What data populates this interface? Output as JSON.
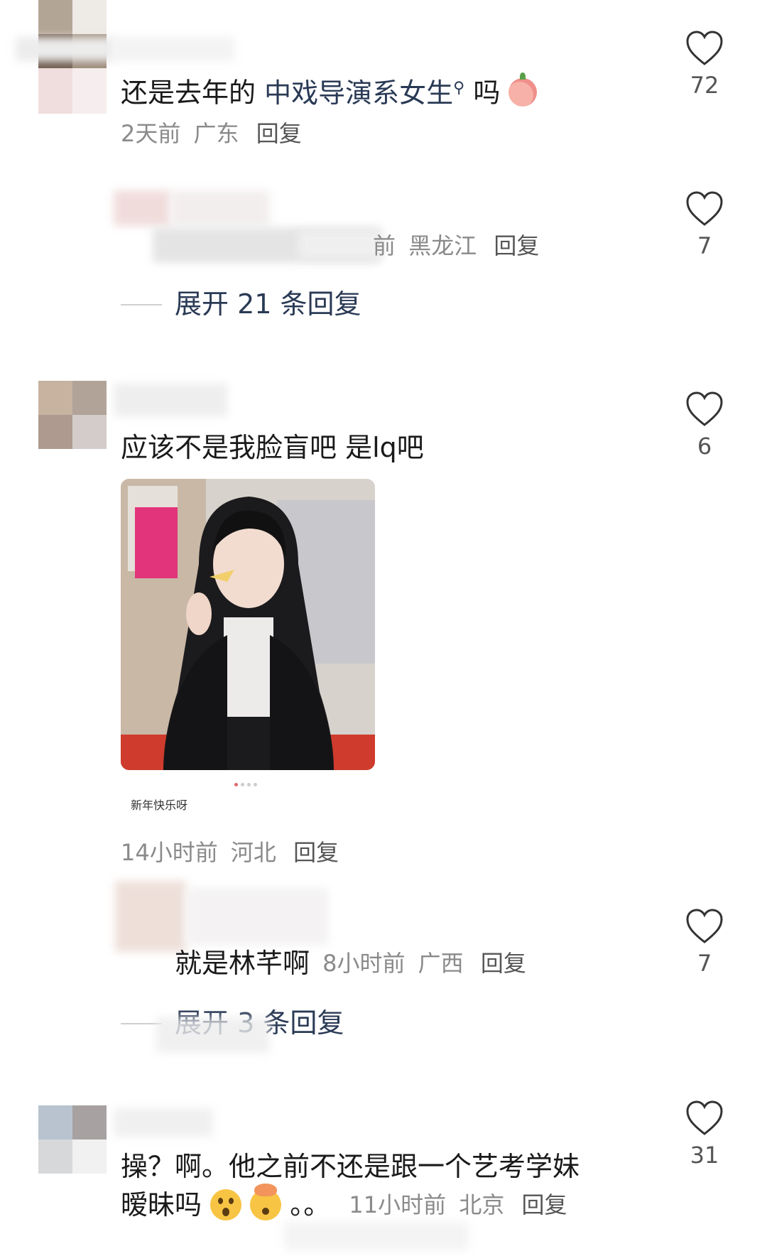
{
  "comments": [
    {
      "text_parts": [
        "还是去年的 ",
        "中戏导演系女生",
        " 吗"
      ],
      "time": "2天前",
      "location": "广东",
      "reply_label": "回复",
      "likes": "72"
    },
    {
      "time_fragment": "前",
      "location": "黑龙江",
      "reply_label": "回复",
      "likes": "7",
      "expand_label": "展开 21 条回复"
    },
    {
      "text": "应该不是我脸盲吧 是lq吧",
      "image_caption": "新年快乐呀",
      "time": "14小时前",
      "location": "河北",
      "reply_label": "回复",
      "likes": "6"
    },
    {
      "text": "就是林芊啊",
      "time": "8小时前",
      "location": "广西",
      "reply_label": "回复",
      "likes": "7",
      "expand_label": "展开 3 条回复"
    },
    {
      "text_line1": "操？啊。他之前不还是跟一个艺考学妹",
      "text_line2": "暧昧吗",
      "text_tail": "。。",
      "time": "11小时前",
      "location": "北京",
      "reply_label": "回复",
      "likes": "31"
    }
  ],
  "icons": {
    "like": "heart-outline-icon",
    "search_link": "search-magnifier-icon",
    "emoji_peach": "peach-emoji-icon",
    "emoji_astonished": "astonished-face-emoji-icon",
    "emoji_mind_blown": "exploding-head-emoji-icon"
  },
  "colors": {
    "text": "#1a1a1a",
    "meta": "#8a8a8a",
    "expand": "#2a3a55",
    "heart": "#333333"
  }
}
